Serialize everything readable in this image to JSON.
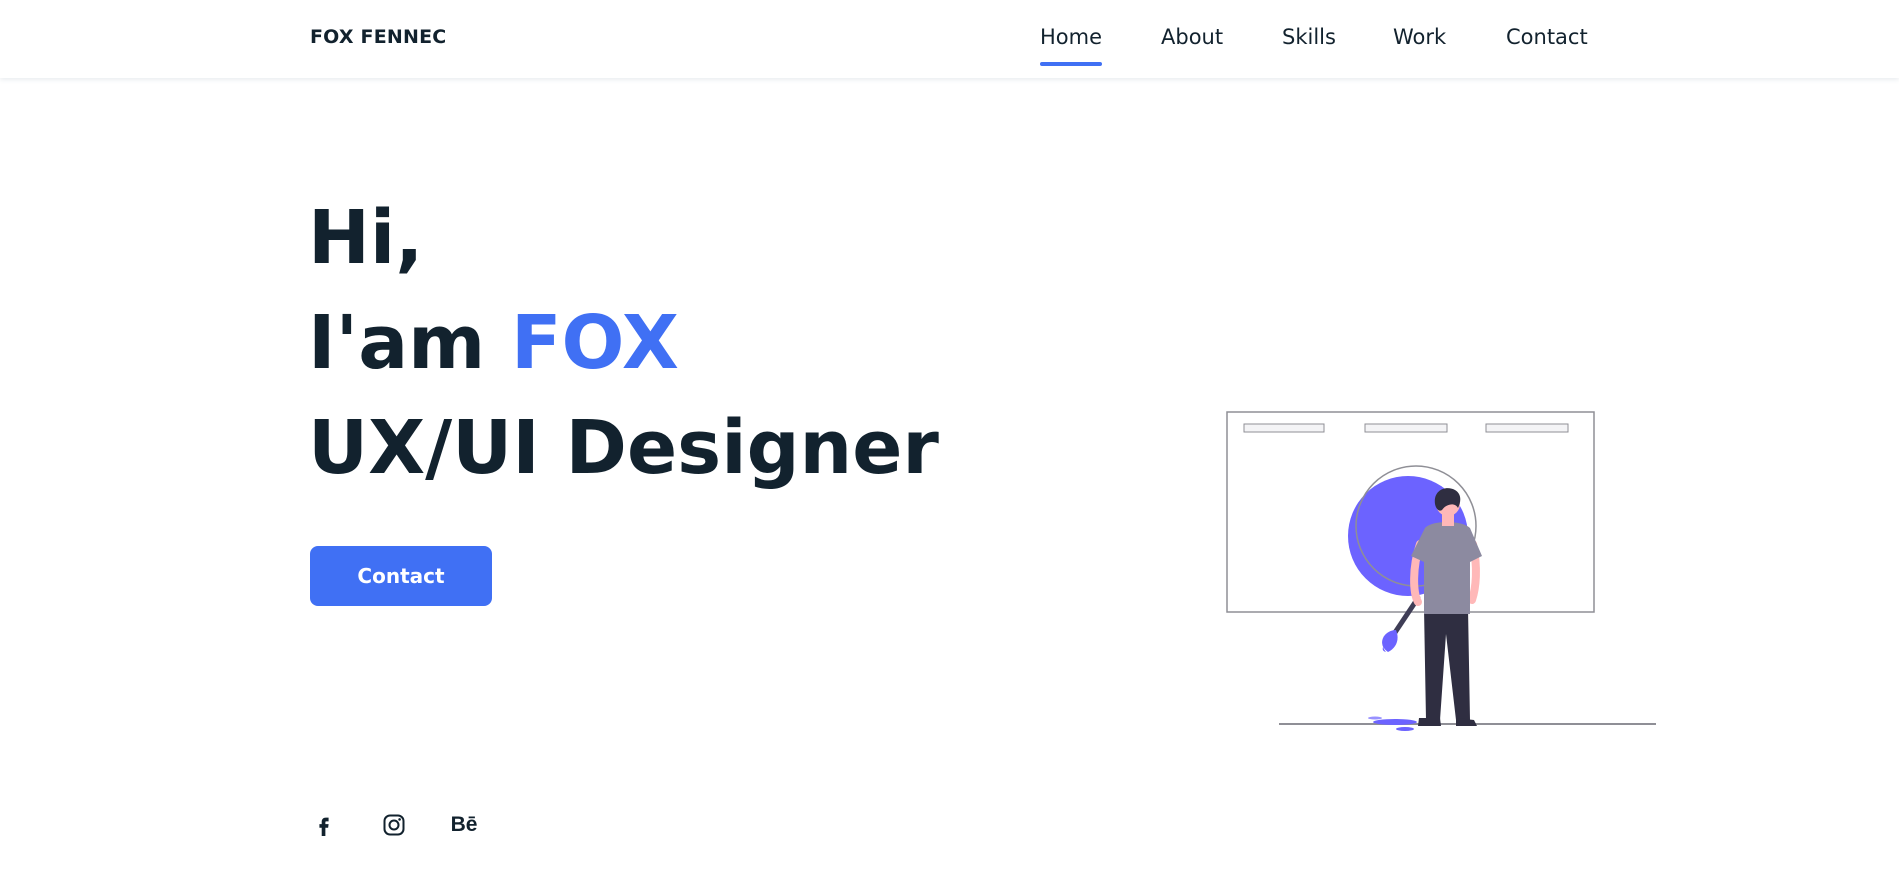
{
  "header": {
    "logo": "FOX FENNEC",
    "nav": [
      {
        "label": "Home",
        "active": true
      },
      {
        "label": "About",
        "active": false
      },
      {
        "label": "Skills",
        "active": false
      },
      {
        "label": "Work",
        "active": false
      },
      {
        "label": "Contact",
        "active": false
      }
    ]
  },
  "hero": {
    "line1": "Hi,",
    "line2_prefix": "I'am ",
    "line2_name": "FOX",
    "line3": "UX/UI Designer",
    "button_label": "Contact"
  },
  "social": {
    "icons": [
      "facebook-icon",
      "instagram-icon",
      "behance-icon"
    ],
    "behance_label": "Bē"
  },
  "colors": {
    "accent": "#4070f4",
    "text": "#12222e",
    "illustration_accent": "#6c63ff"
  }
}
